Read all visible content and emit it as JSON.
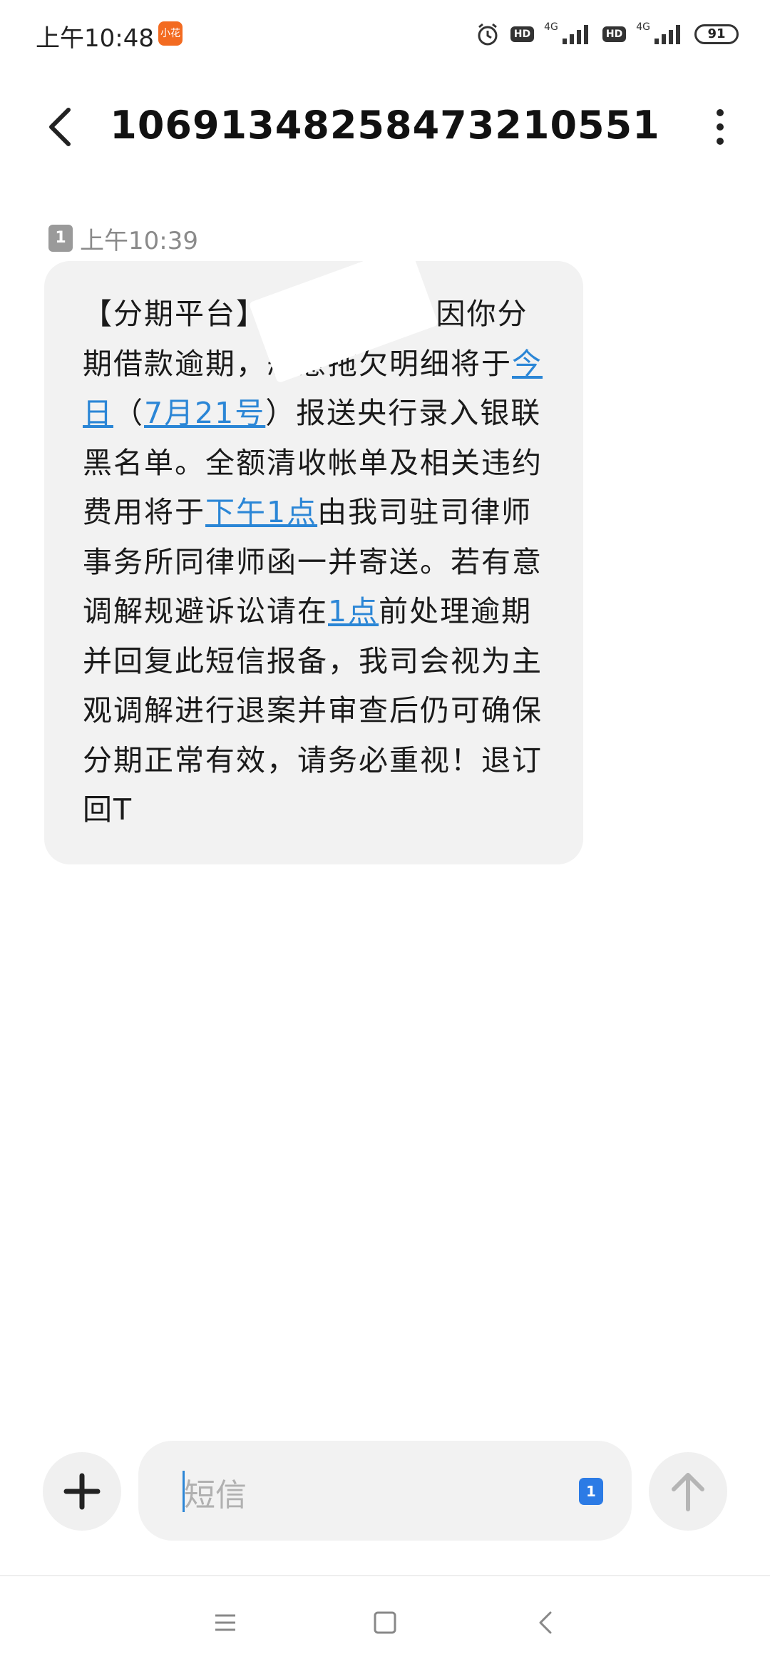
{
  "status_bar": {
    "time": "上午10:48",
    "notification_app": "小花",
    "hd_label": "HD",
    "network_label": "4G",
    "battery": "91"
  },
  "header": {
    "title": "1069134825847321055​1",
    "back_icon": "chevron-left-icon",
    "more_icon": "more-vertical-icon"
  },
  "message": {
    "sim": "1",
    "time": "上午10:39",
    "segments": [
      {
        "text": "【分期平台】",
        "link": false
      },
      {
        "text": "　　　　　　",
        "link": false
      },
      {
        "text": "因你分期借款逾期，恶意拖欠明细将于",
        "link": false
      },
      {
        "text": "今日",
        "link": true
      },
      {
        "text": "（",
        "link": false
      },
      {
        "text": "7月21号",
        "link": true
      },
      {
        "text": "）报送央行录入银联黑名单。全额清收帐单及相关违约费用将于",
        "link": false
      },
      {
        "text": "下午1点",
        "link": true
      },
      {
        "text": "由我司驻司律师事务所同律师函一并寄送。若有意调解规避诉讼请在",
        "link": false
      },
      {
        "text": "1点",
        "link": true
      },
      {
        "text": "前处理逾期并回复此短信报备，我司会视为主观调解进行退案并审查后仍可确保分期正常有效，请务必重视！退订回T",
        "link": false
      }
    ]
  },
  "composer": {
    "placeholder": "短信",
    "sim_select": "1",
    "add_icon": "plus-icon",
    "send_icon": "arrow-up-icon"
  },
  "nav_bar": {
    "menu_icon": "menu-icon",
    "home_icon": "square-home-icon",
    "back_icon": "triangle-back-icon"
  },
  "colors": {
    "link": "#2b86d6",
    "bubble": "#f2f2f2",
    "sim_badge": "#2c7be5"
  }
}
